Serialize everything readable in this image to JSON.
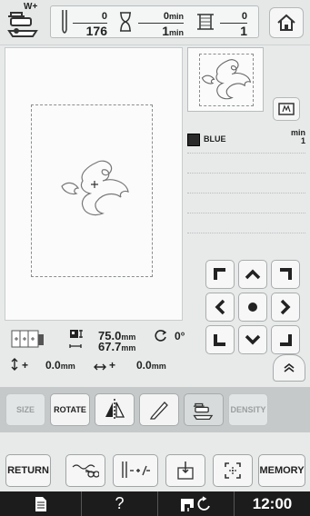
{
  "topbar": {
    "presser_label": "W+",
    "stitch_current": "0",
    "stitch_total": "176",
    "time_current": "0",
    "time_total": "1",
    "time_unit": "min",
    "color_current": "0",
    "color_total": "1"
  },
  "colors_panel": {
    "min_label": "min",
    "min_value": "1",
    "items": [
      {
        "name": "BLUE",
        "swatch": "#2a2a2a"
      }
    ]
  },
  "info": {
    "width_value": "75.0",
    "height_value": "67.7",
    "unit": "mm",
    "rotation": "0°",
    "offset_y": "0.0",
    "offset_x": "0.0",
    "offset_y_prefix": "+",
    "offset_x_prefix": "+"
  },
  "tools": {
    "size": "SIZE",
    "rotate": "ROTATE",
    "density": "DENSITY"
  },
  "bottom": {
    "return": "RETURN",
    "memory": "MEMORY"
  },
  "footer": {
    "help": "?",
    "clock": "12:00"
  }
}
